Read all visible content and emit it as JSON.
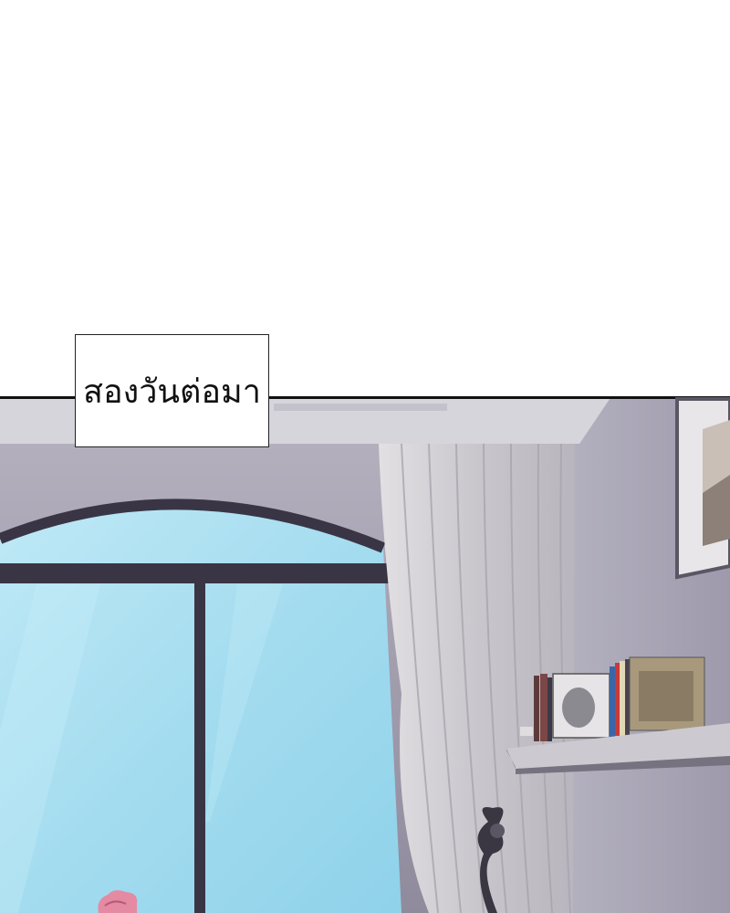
{
  "caption": {
    "text": "สองวันต่อมา"
  },
  "colors": {
    "wall": "#9f9cad",
    "ceiling": "#d4d2da",
    "sky": "#a9def0",
    "window_frame": "#3a3545",
    "curtain": "#d6d3d6",
    "shelf": "#cfcbd2"
  }
}
